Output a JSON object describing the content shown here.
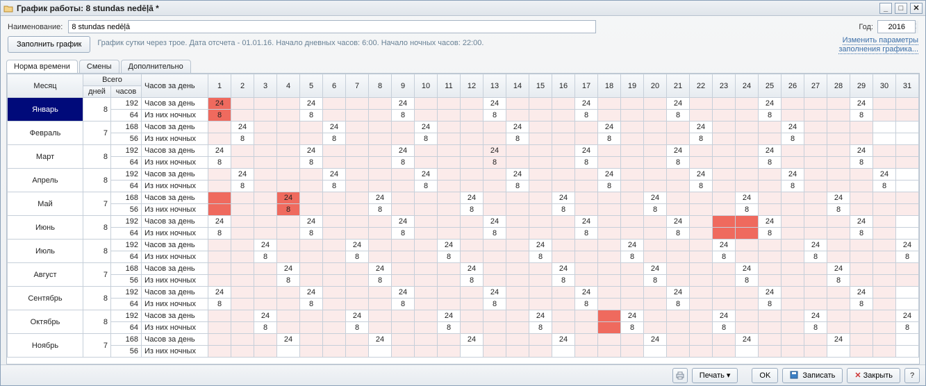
{
  "window": {
    "title": "График работы: 8 stundas nedēļā *"
  },
  "toolbar": {
    "name_label": "Наименование:",
    "name_value": "8 stundas nedēļā",
    "year_label": "Год:",
    "year_value": "2016",
    "fill_button": "Заполнить график",
    "summary": "График сутки через трое. Дата отсчета - 01.01.16. Начало дневных часов: 6:00. Начало ночных часов: 22:00.",
    "change_params_link1": "Изменить параметры",
    "change_params_link2": "заполнения графика..."
  },
  "tabs": {
    "norma": "Норма времени",
    "smeny": "Смены",
    "dop": "Дополнительно"
  },
  "grid": {
    "headers": {
      "month": "Месяц",
      "total": "Всего",
      "days": "дней",
      "hours": "часов",
      "hours_per_day": "Часов за день",
      "row_day": "Часов за день",
      "row_night": "Из них ночных"
    },
    "day_labels": [
      "1",
      "2",
      "3",
      "4",
      "5",
      "6",
      "7",
      "8",
      "9",
      "10",
      "11",
      "12",
      "13",
      "14",
      "15",
      "16",
      "17",
      "18",
      "19",
      "20",
      "21",
      "22",
      "23",
      "24",
      "25",
      "26",
      "27",
      "28",
      "29",
      "30",
      "31"
    ],
    "months": [
      {
        "name": "Январь",
        "selected": true,
        "days": 8,
        "hours": 192,
        "night_hours": 64,
        "day_row": [
          "r24",
          "",
          "",
          "",
          "24",
          "",
          "",
          "",
          "24",
          "",
          "",
          "",
          "24",
          "",
          "",
          "",
          "24",
          "",
          "",
          "",
          "24",
          "",
          "",
          "",
          "24",
          "",
          "",
          "",
          "24",
          "",
          ""
        ],
        "night_row": [
          "r8",
          "",
          "",
          "",
          "8",
          "",
          "",
          "",
          "8",
          "",
          "",
          "",
          "8",
          "",
          "",
          "",
          "8",
          "",
          "",
          "",
          "8",
          "",
          "",
          "",
          "8",
          "",
          "",
          "",
          "8",
          "",
          ""
        ],
        "pink": [
          2,
          3,
          4,
          6,
          7,
          8,
          10,
          11,
          12,
          14,
          15,
          16,
          18,
          19,
          20,
          22,
          23,
          24,
          26,
          27,
          28,
          30,
          31
        ]
      },
      {
        "name": "Февраль",
        "days": 7,
        "hours": 168,
        "night_hours": 56,
        "day_row": [
          "",
          "24",
          "",
          "",
          "",
          "24",
          "",
          "",
          "",
          "24",
          "",
          "",
          "",
          "24",
          "",
          "",
          "",
          "24",
          "",
          "",
          "",
          "24",
          "",
          "",
          "",
          "24",
          "",
          "",
          "",
          "",
          ""
        ],
        "night_row": [
          "",
          "8",
          "",
          "",
          "",
          "8",
          "",
          "",
          "",
          "8",
          "",
          "",
          "",
          "8",
          "",
          "",
          "",
          "8",
          "",
          "",
          "",
          "8",
          "",
          "",
          "",
          "8",
          "",
          "",
          "",
          "",
          ""
        ],
        "pink": [
          1,
          3,
          4,
          5,
          7,
          8,
          9,
          11,
          12,
          13,
          15,
          16,
          17,
          19,
          20,
          21,
          23,
          24,
          25,
          27,
          28,
          29
        ]
      },
      {
        "name": "Март",
        "days": 8,
        "hours": 192,
        "night_hours": 64,
        "day_row": [
          "24",
          "",
          "",
          "",
          "24",
          "",
          "",
          "",
          "24",
          "",
          "",
          "",
          "24",
          "",
          "",
          "",
          "24",
          "",
          "",
          "",
          "24",
          "",
          "",
          "",
          "24",
          "",
          "",
          "",
          "24",
          "",
          ""
        ],
        "night_row": [
          "8",
          "",
          "",
          "",
          "8",
          "",
          "",
          "",
          "8",
          "",
          "",
          "",
          "8",
          "",
          "",
          "",
          "8",
          "",
          "",
          "",
          "8",
          "",
          "",
          "",
          "8",
          "",
          "",
          "",
          "8",
          "",
          ""
        ],
        "pink": [
          2,
          3,
          4,
          6,
          7,
          8,
          10,
          11,
          12,
          13,
          14,
          15,
          16,
          18,
          19,
          20,
          22,
          23,
          24,
          26,
          27,
          28,
          30,
          31
        ]
      },
      {
        "name": "Апрель",
        "days": 8,
        "hours": 192,
        "night_hours": 64,
        "day_row": [
          "",
          "24",
          "",
          "",
          "",
          "24",
          "",
          "",
          "",
          "24",
          "",
          "",
          "",
          "24",
          "",
          "",
          "",
          "24",
          "",
          "",
          "",
          "24",
          "",
          "",
          "",
          "24",
          "",
          "",
          "",
          "24",
          ""
        ],
        "night_row": [
          "",
          "8",
          "",
          "",
          "",
          "8",
          "",
          "",
          "",
          "8",
          "",
          "",
          "",
          "8",
          "",
          "",
          "",
          "8",
          "",
          "",
          "",
          "8",
          "",
          "",
          "",
          "8",
          "",
          "",
          "",
          "8",
          ""
        ],
        "pink": [
          1,
          3,
          4,
          5,
          7,
          8,
          9,
          11,
          12,
          13,
          15,
          16,
          17,
          19,
          20,
          21,
          23,
          24,
          25,
          27,
          28,
          29
        ]
      },
      {
        "name": "Май",
        "days": 7,
        "hours": 168,
        "night_hours": 56,
        "day_row": [
          "r",
          "",
          "",
          "r24",
          "",
          "",
          "",
          "24",
          "",
          "",
          "",
          "24",
          "",
          "",
          "",
          "24",
          "",
          "",
          "",
          "24",
          "",
          "",
          "",
          "24",
          "",
          "",
          "",
          "24",
          "",
          "",
          ""
        ],
        "night_row": [
          "r",
          "",
          "",
          "r8",
          "",
          "",
          "",
          "8",
          "",
          "",
          "",
          "8",
          "",
          "",
          "",
          "8",
          "",
          "",
          "",
          "8",
          "",
          "",
          "",
          "8",
          "",
          "",
          "",
          "8",
          "",
          "",
          ""
        ],
        "pink": [
          2,
          3,
          5,
          6,
          7,
          9,
          10,
          11,
          13,
          14,
          15,
          17,
          18,
          19,
          21,
          22,
          23,
          25,
          26,
          27,
          29,
          30,
          31
        ]
      },
      {
        "name": "Июнь",
        "days": 8,
        "hours": 192,
        "night_hours": 64,
        "day_row": [
          "24",
          "",
          "",
          "",
          "24",
          "",
          "",
          "",
          "24",
          "",
          "",
          "",
          "24",
          "",
          "",
          "",
          "24",
          "",
          "",
          "",
          "24",
          "",
          "r",
          "r",
          "24",
          "",
          "",
          "",
          "24",
          "",
          ""
        ],
        "night_row": [
          "8",
          "",
          "",
          "",
          "8",
          "",
          "",
          "",
          "8",
          "",
          "",
          "",
          "8",
          "",
          "",
          "",
          "8",
          "",
          "",
          "",
          "8",
          "",
          "r",
          "r",
          "8",
          "",
          "",
          "",
          "8",
          "",
          ""
        ],
        "pink": [
          2,
          3,
          4,
          6,
          7,
          8,
          10,
          11,
          12,
          14,
          15,
          16,
          18,
          19,
          20,
          22,
          26,
          27,
          28,
          30
        ]
      },
      {
        "name": "Июль",
        "days": 8,
        "hours": 192,
        "night_hours": 64,
        "day_row": [
          "",
          "",
          "24",
          "",
          "",
          "",
          "24",
          "",
          "",
          "",
          "24",
          "",
          "",
          "",
          "24",
          "",
          "",
          "",
          "24",
          "",
          "",
          "",
          "24",
          "",
          "",
          "",
          "24",
          "",
          "",
          "",
          "24"
        ],
        "night_row": [
          "",
          "",
          "8",
          "",
          "",
          "",
          "8",
          "",
          "",
          "",
          "8",
          "",
          "",
          "",
          "8",
          "",
          "",
          "",
          "8",
          "",
          "",
          "",
          "8",
          "",
          "",
          "",
          "8",
          "",
          "",
          "",
          "8"
        ],
        "pink": [
          1,
          2,
          4,
          5,
          6,
          8,
          9,
          10,
          12,
          13,
          14,
          16,
          17,
          18,
          20,
          21,
          22,
          24,
          25,
          26,
          28,
          29,
          30
        ]
      },
      {
        "name": "Август",
        "days": 7,
        "hours": 168,
        "night_hours": 56,
        "day_row": [
          "",
          "",
          "",
          "24",
          "",
          "",
          "",
          "24",
          "",
          "",
          "",
          "24",
          "",
          "",
          "",
          "24",
          "",
          "",
          "",
          "24",
          "",
          "",
          "",
          "24",
          "",
          "",
          "",
          "24",
          "",
          "",
          ""
        ],
        "night_row": [
          "",
          "",
          "",
          "8",
          "",
          "",
          "",
          "8",
          "",
          "",
          "",
          "8",
          "",
          "",
          "",
          "8",
          "",
          "",
          "",
          "8",
          "",
          "",
          "",
          "8",
          "",
          "",
          "",
          "8",
          "",
          "",
          ""
        ],
        "pink": [
          1,
          2,
          3,
          5,
          6,
          7,
          9,
          10,
          11,
          13,
          14,
          15,
          17,
          18,
          19,
          21,
          22,
          23,
          25,
          26,
          27,
          29,
          30,
          31
        ]
      },
      {
        "name": "Сентябрь",
        "days": 8,
        "hours": 192,
        "night_hours": 64,
        "day_row": [
          "24",
          "",
          "",
          "",
          "24",
          "",
          "",
          "",
          "24",
          "",
          "",
          "",
          "24",
          "",
          "",
          "",
          "24",
          "",
          "",
          "",
          "24",
          "",
          "",
          "",
          "24",
          "",
          "",
          "",
          "24",
          "",
          ""
        ],
        "night_row": [
          "8",
          "",
          "",
          "",
          "8",
          "",
          "",
          "",
          "8",
          "",
          "",
          "",
          "8",
          "",
          "",
          "",
          "8",
          "",
          "",
          "",
          "8",
          "",
          "",
          "",
          "8",
          "",
          "",
          "",
          "8",
          "",
          ""
        ],
        "pink": [
          2,
          3,
          4,
          6,
          7,
          8,
          10,
          11,
          12,
          14,
          15,
          16,
          18,
          19,
          20,
          22,
          23,
          24,
          26,
          27,
          28,
          30
        ]
      },
      {
        "name": "Октябрь",
        "days": 8,
        "hours": 192,
        "night_hours": 64,
        "day_row": [
          "",
          "",
          "24",
          "",
          "",
          "",
          "24",
          "",
          "",
          "",
          "24",
          "",
          "",
          "",
          "24",
          "",
          "",
          "r",
          "24",
          "",
          "",
          "",
          "24",
          "",
          "",
          "",
          "24",
          "",
          "",
          "",
          "24"
        ],
        "night_row": [
          "",
          "",
          "8",
          "",
          "",
          "",
          "8",
          "",
          "",
          "",
          "8",
          "",
          "",
          "",
          "8",
          "",
          "",
          "r",
          "8",
          "",
          "",
          "",
          "8",
          "",
          "",
          "",
          "8",
          "",
          "",
          "",
          "8"
        ],
        "pink": [
          1,
          2,
          4,
          5,
          6,
          8,
          9,
          10,
          12,
          13,
          14,
          16,
          17,
          20,
          21,
          22,
          24,
          25,
          26,
          28,
          29,
          30
        ]
      },
      {
        "name": "Ноябрь",
        "days": 7,
        "hours": 168,
        "night_hours": 56,
        "day_row": [
          "",
          "",
          "",
          "24",
          "",
          "",
          "",
          "24",
          "",
          "",
          "",
          "24",
          "",
          "",
          "",
          "24",
          "",
          "",
          "",
          "24",
          "",
          "",
          "",
          "24",
          "",
          "",
          "",
          "24",
          "",
          "",
          ""
        ],
        "night_row": [
          "",
          "",
          "",
          "",
          "",
          "",
          "",
          "",
          "",
          "",
          "",
          "",
          "",
          "",
          "",
          "",
          "",
          "",
          "",
          "",
          "",
          "",
          "",
          "",
          "",
          "",
          "",
          "",
          "",
          "",
          ""
        ],
        "pink": [
          1,
          2,
          3,
          5,
          6,
          7,
          9,
          10,
          11,
          13,
          14,
          15,
          17,
          18,
          19,
          21,
          22,
          23,
          25,
          26,
          27,
          29,
          30
        ]
      }
    ]
  },
  "footer": {
    "print": "Печать",
    "ok": "OK",
    "save": "Записать",
    "close": "Закрыть"
  }
}
